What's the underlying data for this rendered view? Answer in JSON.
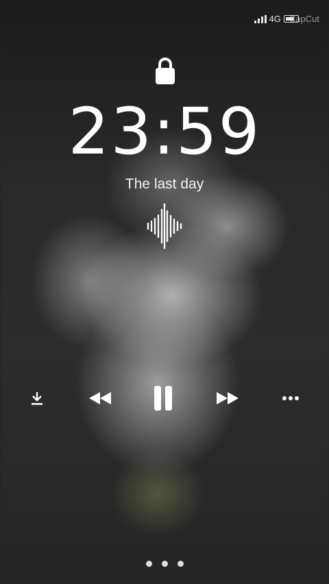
{
  "status_bar": {
    "network": "4G",
    "watermark": "CapCut",
    "icons": [
      "signal-icon",
      "battery-icon"
    ]
  },
  "lock_screen": {
    "lock_icon": "lock-icon",
    "time": "23:59",
    "now_playing_title": "The last day",
    "waveform_icon": "waveform-icon"
  },
  "player_controls": {
    "download_icon": "download-icon",
    "previous_icon": "rewind-icon",
    "play_pause_icon": "pause-icon",
    "next_icon": "fast-forward-icon",
    "more_icon": "more-icon"
  },
  "page_indicator": {
    "count": 3
  },
  "colors": {
    "foreground": "#ffffff",
    "background": "#232323"
  }
}
